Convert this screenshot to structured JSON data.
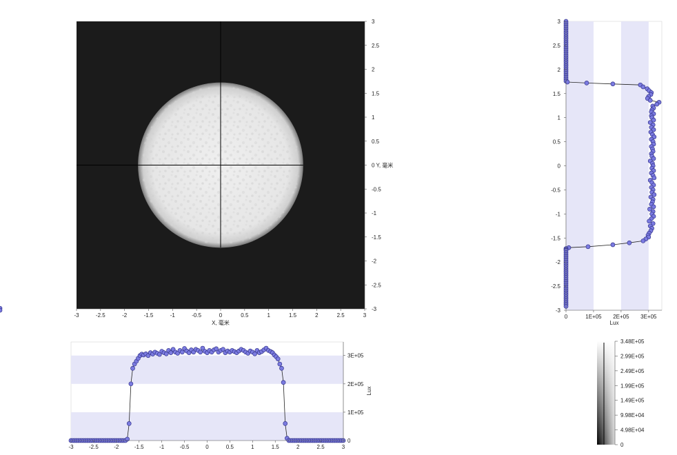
{
  "colors": {
    "heatmap_background": "#1b1b1b",
    "band_fill": "#e6e6f8",
    "marker_fill": "#7b7be0",
    "marker_stroke": "#33338a",
    "line": "#222222",
    "crosshair": "#000000"
  },
  "chart_data": [
    {
      "type": "heatmap",
      "name": "irradiance-map",
      "x_axis_label": "X, 毫米",
      "y_axis_label": "Y, 毫米",
      "xlim": [
        -3,
        3
      ],
      "ylim": [
        -3,
        3
      ],
      "x_ticks": [
        "-3",
        "-2.5",
        "-2",
        "-1.5",
        "-1",
        "-0.5",
        "0",
        "0.5",
        "1",
        "1.5",
        "2",
        "2.5",
        "3"
      ],
      "y_ticks": [
        "3",
        "2.5",
        "2",
        "1.5",
        "1",
        "0.5",
        "0",
        "-0.5",
        "-1",
        "-1.5",
        "-2",
        "-2.5",
        "-3"
      ],
      "spot": {
        "shape": "circle",
        "center": [
          0,
          0
        ],
        "radius": 1.72
      },
      "crosshair_at": [
        0,
        0
      ]
    },
    {
      "type": "line",
      "name": "horizontal-profile",
      "xlim": [
        -3,
        3
      ],
      "ylim": [
        0,
        348000
      ],
      "x_ticks": [
        "-3",
        "-2.5",
        "-2",
        "-1.5",
        "-1",
        "-0.5",
        "0",
        "0.5",
        "1",
        "1.5",
        "2",
        "2.5",
        "3"
      ],
      "y_ticks": [
        "3E+05",
        "2E+05",
        "1E+05",
        "0"
      ],
      "y_tick_values": [
        300000,
        200000,
        100000,
        0
      ],
      "ylabel": "Lux",
      "bands": [
        [
          0,
          100000
        ],
        [
          200000,
          300000
        ]
      ],
      "x": [
        -3.0,
        -2.96,
        -2.92,
        -2.88,
        -2.84,
        -2.8,
        -2.76,
        -2.72,
        -2.68,
        -2.64,
        -2.6,
        -2.56,
        -2.52,
        -2.48,
        -2.44,
        -2.4,
        -2.36,
        -2.32,
        -2.28,
        -2.24,
        -2.2,
        -2.16,
        -2.12,
        -2.08,
        -2.04,
        -2.0,
        -1.96,
        -1.92,
        -1.88,
        -1.84,
        -1.8,
        -1.76,
        -1.72,
        -1.68,
        -1.64,
        -1.6,
        -1.56,
        -1.52,
        -1.48,
        -1.44,
        -1.4,
        -1.35,
        -1.3,
        -1.25,
        -1.2,
        -1.15,
        -1.1,
        -1.05,
        -1.0,
        -0.95,
        -0.9,
        -0.85,
        -0.8,
        -0.75,
        -0.7,
        -0.65,
        -0.6,
        -0.55,
        -0.5,
        -0.45,
        -0.4,
        -0.35,
        -0.3,
        -0.25,
        -0.2,
        -0.15,
        -0.1,
        -0.05,
        0.0,
        0.05,
        0.1,
        0.15,
        0.2,
        0.25,
        0.3,
        0.35,
        0.4,
        0.45,
        0.5,
        0.55,
        0.6,
        0.65,
        0.7,
        0.75,
        0.8,
        0.85,
        0.9,
        0.95,
        1.0,
        1.05,
        1.1,
        1.15,
        1.2,
        1.25,
        1.3,
        1.35,
        1.4,
        1.44,
        1.48,
        1.52,
        1.56,
        1.6,
        1.64,
        1.68,
        1.72,
        1.76,
        1.8,
        1.84,
        1.88,
        1.92,
        1.96,
        2.0,
        2.04,
        2.08,
        2.12,
        2.16,
        2.2,
        2.24,
        2.28,
        2.32,
        2.36,
        2.4,
        2.44,
        2.48,
        2.52,
        2.56,
        2.6,
        2.64,
        2.68,
        2.72,
        2.76,
        2.8,
        2.84,
        2.88,
        2.92,
        2.96,
        3.0
      ],
      "y": [
        0,
        0,
        0,
        0,
        0,
        0,
        0,
        0,
        0,
        0,
        0,
        0,
        0,
        0,
        0,
        0,
        0,
        0,
        0,
        0,
        0,
        0,
        0,
        0,
        0,
        0,
        0,
        0,
        0,
        0,
        0,
        5000,
        60000,
        200000,
        255000,
        270000,
        280000,
        290000,
        300000,
        305000,
        302000,
        306000,
        300000,
        310000,
        305000,
        312000,
        308000,
        304000,
        315000,
        310000,
        306000,
        318000,
        310000,
        322000,
        312000,
        308000,
        318000,
        312000,
        325000,
        316000,
        310000,
        320000,
        312000,
        322000,
        318000,
        312000,
        326000,
        315000,
        310000,
        318000,
        312000,
        320000,
        324000,
        312000,
        318000,
        322000,
        310000,
        316000,
        312000,
        318000,
        314000,
        310000,
        316000,
        322000,
        318000,
        312000,
        308000,
        316000,
        312000,
        306000,
        318000,
        310000,
        314000,
        320000,
        326000,
        318000,
        314000,
        310000,
        302000,
        296000,
        288000,
        270000,
        255000,
        205000,
        60000,
        8000,
        0,
        0,
        0,
        0,
        0,
        0,
        0,
        0,
        0,
        0,
        0,
        0,
        0,
        0,
        0,
        0,
        0,
        0,
        0,
        0,
        0,
        0,
        0,
        0,
        0,
        0,
        0,
        0,
        0,
        0,
        0
      ]
    },
    {
      "type": "line",
      "name": "vertical-profile",
      "orientation": "vertical",
      "xlim": [
        0,
        348000
      ],
      "ylim": [
        -3,
        3
      ],
      "x_ticks": [
        "0",
        "1E+05",
        "2E+05",
        "3E+05"
      ],
      "x_tick_values": [
        0,
        100000,
        200000,
        300000
      ],
      "y_ticks": [
        "3",
        "2.5",
        "2",
        "1.5",
        "1",
        "0.5",
        "0",
        "-0.5",
        "-1",
        "-1.5",
        "-2",
        "-2.5",
        "-3"
      ],
      "xlabel": "Lux",
      "bands": [
        [
          0,
          100000
        ],
        [
          200000,
          300000
        ]
      ],
      "y": [
        3.0,
        2.96,
        2.92,
        2.88,
        2.84,
        2.8,
        2.76,
        2.72,
        2.68,
        2.64,
        2.6,
        2.56,
        2.52,
        2.48,
        2.44,
        2.4,
        2.36,
        2.32,
        2.28,
        2.24,
        2.2,
        2.16,
        2.12,
        2.08,
        2.04,
        2.0,
        1.96,
        1.92,
        1.88,
        1.84,
        1.8,
        1.76,
        1.74,
        1.72,
        1.7,
        1.68,
        1.64,
        1.6,
        1.56,
        1.52,
        1.48,
        1.44,
        1.4,
        1.36,
        1.32,
        1.28,
        1.24,
        1.2,
        1.16,
        1.12,
        1.08,
        1.04,
        1.0,
        0.95,
        0.9,
        0.85,
        0.8,
        0.75,
        0.7,
        0.65,
        0.6,
        0.55,
        0.5,
        0.45,
        0.4,
        0.35,
        0.3,
        0.25,
        0.2,
        0.15,
        0.1,
        0.05,
        0.0,
        -0.05,
        -0.1,
        -0.15,
        -0.2,
        -0.25,
        -0.3,
        -0.35,
        -0.4,
        -0.45,
        -0.5,
        -0.55,
        -0.6,
        -0.65,
        -0.7,
        -0.75,
        -0.8,
        -0.85,
        -0.9,
        -0.95,
        -1.0,
        -1.05,
        -1.1,
        -1.15,
        -1.2,
        -1.25,
        -1.3,
        -1.35,
        -1.4,
        -1.44,
        -1.48,
        -1.52,
        -1.56,
        -1.6,
        -1.64,
        -1.68,
        -1.7,
        -1.72,
        -1.74,
        -1.76,
        -1.8,
        -1.84,
        -1.88,
        -1.92,
        -1.96,
        -2.0,
        -2.04,
        -2.08,
        -2.12,
        -2.16,
        -2.2,
        -2.24,
        -2.28,
        -2.32,
        -2.36,
        -2.4,
        -2.44,
        -2.48,
        -2.52,
        -2.56,
        -2.6,
        -2.64,
        -2.68,
        -2.72,
        -2.76,
        -2.8,
        -2.84,
        -2.88,
        -2.92,
        -2.96,
        -3.0
      ],
      "x": [
        0,
        0,
        0,
        0,
        0,
        0,
        0,
        0,
        0,
        0,
        0,
        0,
        0,
        0,
        0,
        0,
        0,
        0,
        0,
        0,
        0,
        0,
        0,
        0,
        0,
        0,
        0,
        0,
        0,
        0,
        0,
        0,
        5000,
        75000,
        170000,
        270000,
        280000,
        295000,
        302000,
        310000,
        308000,
        300000,
        296000,
        306000,
        338000,
        330000,
        315000,
        318000,
        312000,
        310000,
        318000,
        310000,
        312000,
        318000,
        306000,
        316000,
        310000,
        318000,
        308000,
        314000,
        320000,
        310000,
        316000,
        318000,
        310000,
        314000,
        316000,
        310000,
        312000,
        318000,
        306000,
        314000,
        316000,
        312000,
        318000,
        310000,
        316000,
        320000,
        306000,
        312000,
        318000,
        310000,
        316000,
        312000,
        320000,
        308000,
        316000,
        314000,
        310000,
        318000,
        304000,
        316000,
        312000,
        318000,
        310000,
        302000,
        316000,
        306000,
        312000,
        308000,
        302000,
        298000,
        300000,
        290000,
        280000,
        230000,
        170000,
        80000,
        10000,
        0,
        0,
        0,
        0,
        0,
        0,
        0,
        0,
        0,
        0,
        0,
        0,
        0,
        0,
        0,
        0,
        0,
        0,
        0,
        0,
        0,
        0,
        0,
        0,
        0,
        0,
        0,
        0,
        0,
        0,
        0,
        0
      ]
    },
    {
      "type": "colorbar",
      "name": "legend-scale",
      "labels": [
        "3.48E+05",
        "2.99E+05",
        "2.49E+05",
        "1.99E+05",
        "1.49E+05",
        "9.98E+04",
        "4.98E+04",
        "0"
      ],
      "max": 348000,
      "min": 0
    }
  ]
}
